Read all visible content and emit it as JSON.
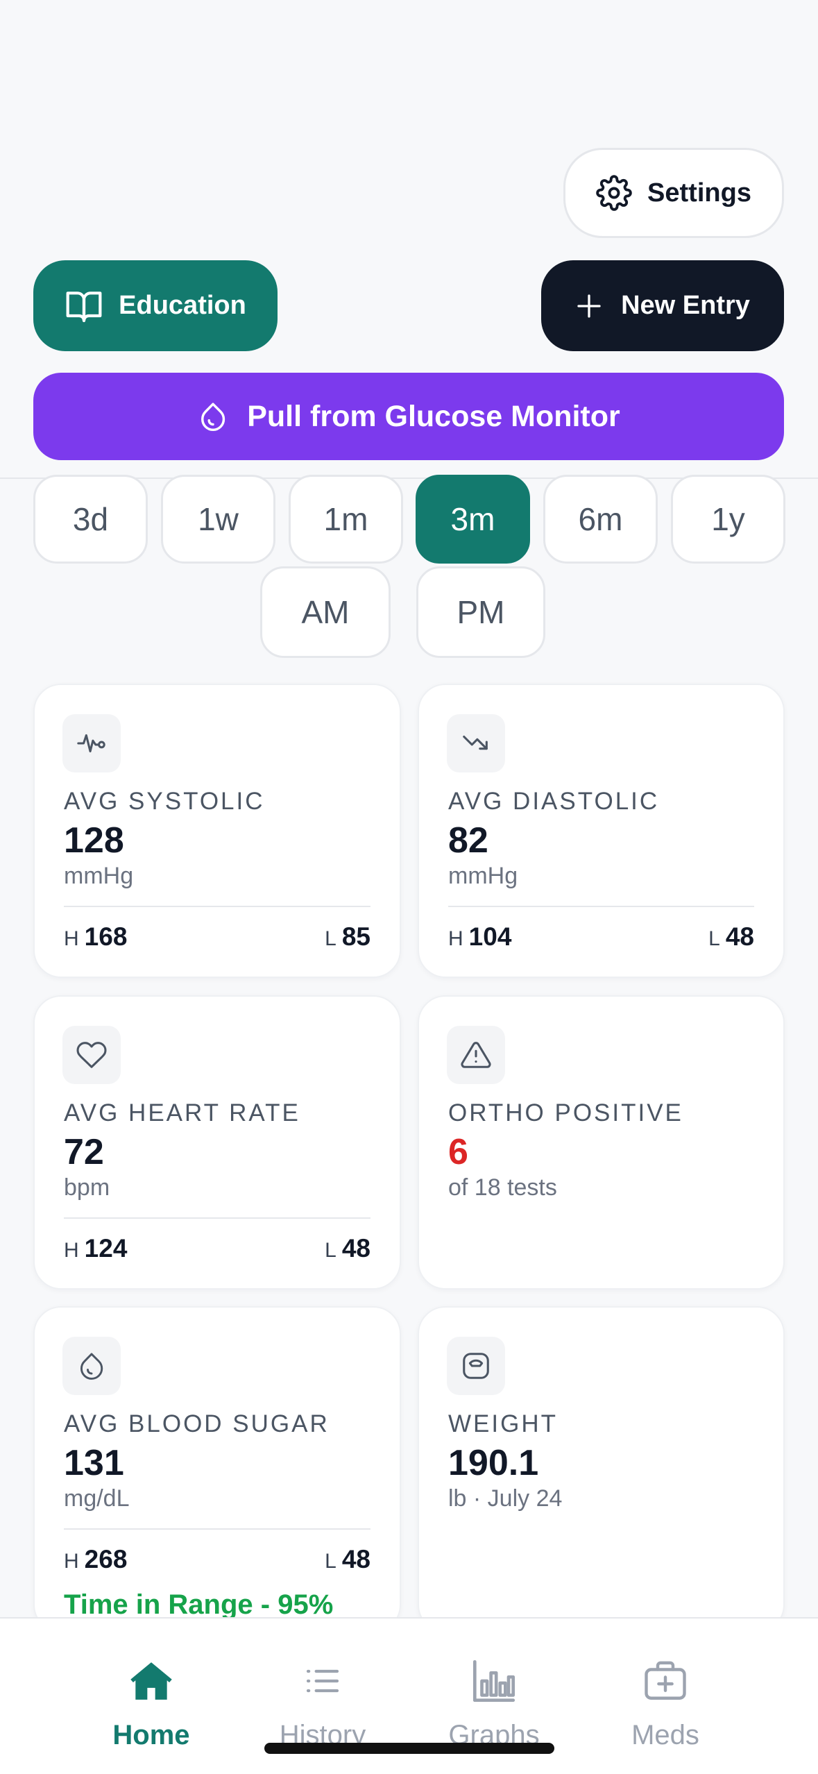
{
  "header": {
    "settings_label": "Settings",
    "education_label": "Education",
    "new_entry_label": "New Entry",
    "pull_label": "Pull from Glucose Monitor"
  },
  "ranges": [
    "3d",
    "1w",
    "1m",
    "3m",
    "6m",
    "1y"
  ],
  "active_range": "3m",
  "periods": [
    "AM",
    "PM"
  ],
  "cards": {
    "systolic": {
      "label": "AVG SYSTOLIC",
      "value": "128",
      "unit": "mmHg",
      "h_key": "H",
      "h": "168",
      "l_key": "L",
      "l": "85",
      "icon": "activity-icon"
    },
    "diastolic": {
      "label": "AVG DIASTOLIC",
      "value": "82",
      "unit": "mmHg",
      "h_key": "H",
      "h": "104",
      "l_key": "L",
      "l": "48",
      "icon": "trending-down-icon"
    },
    "heart": {
      "label": "AVG HEART RATE",
      "value": "72",
      "unit": "bpm",
      "h_key": "H",
      "h": "124",
      "l_key": "L",
      "l": "48",
      "icon": "heart-icon"
    },
    "ortho": {
      "label": "ORTHO POSITIVE",
      "value": "6",
      "unit": "of 18 tests",
      "icon": "warning-icon",
      "value_color": "#dc2626"
    },
    "sugar": {
      "label": "AVG BLOOD SUGAR",
      "value": "131",
      "unit": "mg/dL",
      "h_key": "H",
      "h": "268",
      "l_key": "L",
      "l": "48",
      "tir": "Time in Range - 95%",
      "icon": "droplet-icon"
    },
    "weight": {
      "label": "WEIGHT",
      "value": "190.1",
      "unit": "lb · July 24",
      "icon": "scale-icon"
    }
  },
  "tabs": [
    {
      "label": "Home",
      "icon": "home-icon",
      "active": true
    },
    {
      "label": "History",
      "icon": "list-icon",
      "active": false
    },
    {
      "label": "Graphs",
      "icon": "bar-chart-icon",
      "active": false
    },
    {
      "label": "Meds",
      "icon": "medkit-icon",
      "active": false
    }
  ],
  "colors": {
    "brand_teal": "#137a6e",
    "dark": "#111827",
    "purple": "#7c3aed",
    "green": "#16a34a",
    "red": "#dc2626"
  }
}
